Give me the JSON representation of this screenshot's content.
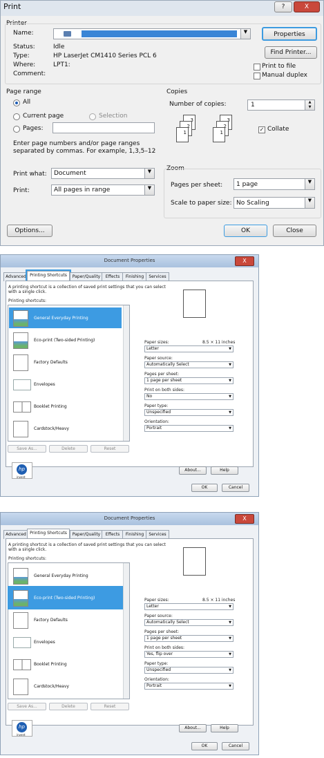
{
  "print_dialog": {
    "title": "Print",
    "help_icon": "?",
    "close_icon": "X",
    "printer_group": "Printer",
    "name_label": "Name:",
    "properties_button": "Properties",
    "status_label": "Status:",
    "status_value": "Idle",
    "type_label": "Type:",
    "type_value": "HP LaserJet CM1410 Series PCL 6",
    "where_label": "Where:",
    "where_value": "LPT1:",
    "comment_label": "Comment:",
    "find_printer_button": "Find Printer...",
    "print_to_file": "Print to file",
    "manual_duplex": "Manual duplex",
    "page_range_group": "Page range",
    "all_option": "All",
    "current_page_option": "Current page",
    "selection_option": "Selection",
    "pages_option": "Pages:",
    "pages_value": "",
    "pages_help": [
      "Enter page numbers and/or page ranges",
      "separated by commas.  For example, 1,3,5–12"
    ],
    "copies_group": "Copies",
    "number_of_copies_label": "Number of copies:",
    "copies_value": "1",
    "collate_label": "Collate",
    "collate_checked": true,
    "print_what_label": "Print what:",
    "print_what_value": "Document",
    "print_label": "Print:",
    "print_value": "All pages in range",
    "zoom_group": "Zoom",
    "pages_per_sheet_label": "Pages per sheet:",
    "pages_per_sheet_value": "1 page",
    "scale_label": "Scale to paper size:",
    "scale_value": "No Scaling",
    "options_button": "Options...",
    "ok_button": "OK",
    "close_button": "Close",
    "collate_pages": [
      "3",
      "2",
      "1",
      "3",
      "2",
      "1"
    ]
  },
  "doc_props_1": {
    "title": "Document Properties",
    "close_icon": "X",
    "tabs": [
      "Advanced",
      "Printing Shortcuts",
      "Paper/Quality",
      "Effects",
      "Finishing",
      "Services"
    ],
    "selected_tab": "Printing Shortcuts",
    "intro": [
      "A printing shortcut is a collection of saved print settings that you can select",
      "with a single click."
    ],
    "shortcuts_label": "Printing shortcuts:",
    "shortcuts": [
      "General Everyday Printing",
      "Eco-print (Two-sided Printing)",
      "Factory Defaults",
      "Envelopes",
      "Booklet Printing",
      "Cardstock/Heavy"
    ],
    "selected_shortcut": "General Everyday Printing",
    "paper_sizes_label": "Paper sizes:",
    "paper_sizes_dim": "8.5 × 11 inches",
    "paper_sizes_value": "Letter",
    "paper_source_label": "Paper source:",
    "paper_source_value": "Automatically Select",
    "pages_per_sheet_label": "Pages per sheet:",
    "pages_per_sheet_value": "1 page per sheet",
    "both_sides_label": "Print on both sides:",
    "both_sides_value": "No",
    "paper_type_label": "Paper type:",
    "paper_type_value": "Unspecified",
    "orientation_label": "Orientation:",
    "orientation_value": "Portrait",
    "save_as_button": "Save As...",
    "delete_button": "Delete",
    "reset_button": "Reset",
    "about_button": "About...",
    "help_button": "Help",
    "ok_button": "OK",
    "cancel_button": "Cancel",
    "hp_logo": "hp",
    "hp_tagline": "invent"
  },
  "doc_props_2": {
    "title": "Document Properties",
    "close_icon": "X",
    "tabs": [
      "Advanced",
      "Printing Shortcuts",
      "Paper/Quality",
      "Effects",
      "Finishing",
      "Services"
    ],
    "selected_tab": "Printing Shortcuts",
    "intro": [
      "A printing shortcut is a collection of saved print settings that you can select",
      "with a single click."
    ],
    "shortcuts_label": "Printing shortcuts:",
    "shortcuts": [
      "General Everyday Printing",
      "Eco-print (Two-sided Printing)",
      "Factory Defaults",
      "Envelopes",
      "Booklet Printing",
      "Cardstock/Heavy"
    ],
    "selected_shortcut": "Eco-print (Two-sided Printing)",
    "paper_sizes_label": "Paper sizes:",
    "paper_sizes_dim": "8.5 × 11 inches",
    "paper_sizes_value": "Letter",
    "paper_source_label": "Paper source:",
    "paper_source_value": "Automatically Select",
    "pages_per_sheet_label": "Pages per sheet:",
    "pages_per_sheet_value": "1 page per sheet",
    "both_sides_label": "Print on both sides:",
    "both_sides_value": "Yes, flip over",
    "paper_type_label": "Paper type:",
    "paper_type_value": "Unspecified",
    "orientation_label": "Orientation:",
    "orientation_value": "Portrait",
    "save_as_button": "Save As...",
    "delete_button": "Delete",
    "reset_button": "Reset",
    "about_button": "About...",
    "help_button": "Help",
    "ok_button": "OK",
    "cancel_button": "Cancel",
    "hp_logo": "hp",
    "hp_tagline": "invent"
  },
  "colors": {
    "selection": "#3d9be2",
    "focus_ring": "#3c9be0",
    "title_bar": "#b6cbe5",
    "close_red": "#c9483b"
  }
}
